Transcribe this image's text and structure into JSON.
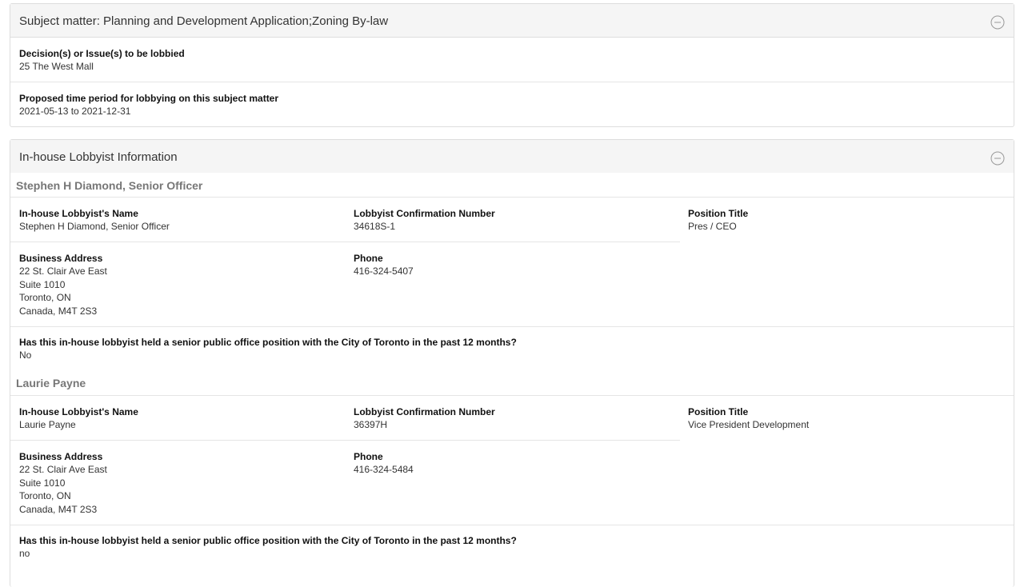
{
  "subject_panel": {
    "title_prefix": "Subject matter: ",
    "title_value": "Planning and Development Application;Zoning By-law",
    "collapse_icon": "minus-circle-icon",
    "decisions_label": "Decision(s) or Issue(s) to be lobbied",
    "decisions_value": "25 The West Mall",
    "period_label": "Proposed time period for lobbying on this subject matter",
    "period_value": "2021-05-13 to 2021-12-31"
  },
  "lobbyist_panel": {
    "title": "In-house Lobbyist Information",
    "collapse_icon": "minus-circle-icon",
    "lobbyists": [
      {
        "heading": "Stephen H Diamond, Senior Officer",
        "name_label": "In-house Lobbyist's Name",
        "name_value": "Stephen H Diamond, Senior Officer",
        "confirmation_label": "Lobbyist Confirmation Number",
        "confirmation_value": "34618S-1",
        "position_label": "Position Title",
        "position_value": "Pres / CEO",
        "address_label": "Business Address",
        "address_line1": "22 St. Clair Ave East",
        "address_line2": "Suite 1010",
        "address_line3": "Toronto, ON",
        "address_line4": "Canada, M4T 2S3",
        "phone_label": "Phone",
        "phone_value": "416-324-5407",
        "senior_label": "Has this in-house lobbyist held a senior public office position with the City of Toronto in the past 12 months?",
        "senior_value": "No"
      },
      {
        "heading": "Laurie Payne",
        "name_label": "In-house Lobbyist's Name",
        "name_value": "Laurie Payne",
        "confirmation_label": "Lobbyist Confirmation Number",
        "confirmation_value": "36397H",
        "position_label": "Position Title",
        "position_value": "Vice President Development",
        "address_label": "Business Address",
        "address_line1": "22 St. Clair Ave East",
        "address_line2": "Suite 1010",
        "address_line3": "Toronto, ON",
        "address_line4": "Canada, M4T 2S3",
        "phone_label": "Phone",
        "phone_value": "416-324-5484",
        "senior_label": "Has this in-house lobbyist held a senior public office position with the City of Toronto in the past 12 months?",
        "senior_value": "no"
      }
    ]
  }
}
